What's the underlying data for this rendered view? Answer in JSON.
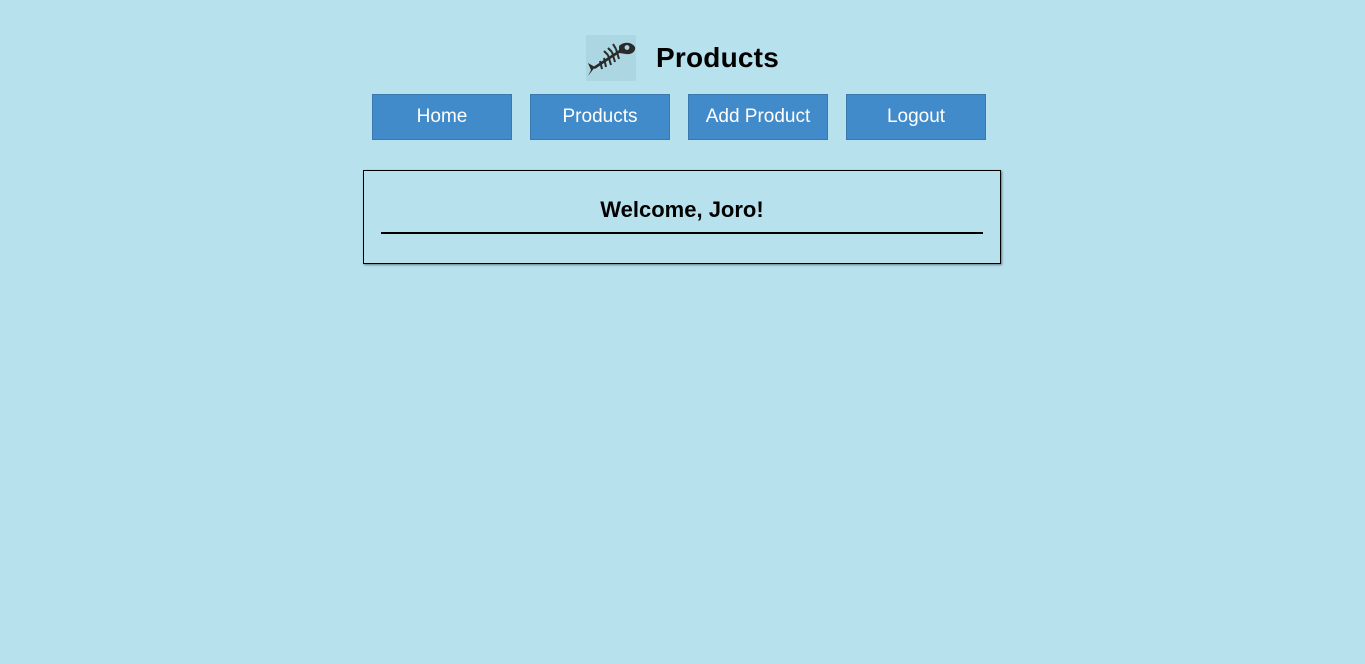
{
  "header": {
    "logo_icon": "fish-skeleton-icon",
    "title": "Products"
  },
  "nav": {
    "items": [
      {
        "label": "Home"
      },
      {
        "label": "Products"
      },
      {
        "label": "Add Product"
      },
      {
        "label": "Logout"
      }
    ]
  },
  "welcome": {
    "message": "Welcome, Joro!"
  },
  "colors": {
    "background": "#b7e1ed",
    "button": "#428bca",
    "button_text": "#ffffff"
  }
}
